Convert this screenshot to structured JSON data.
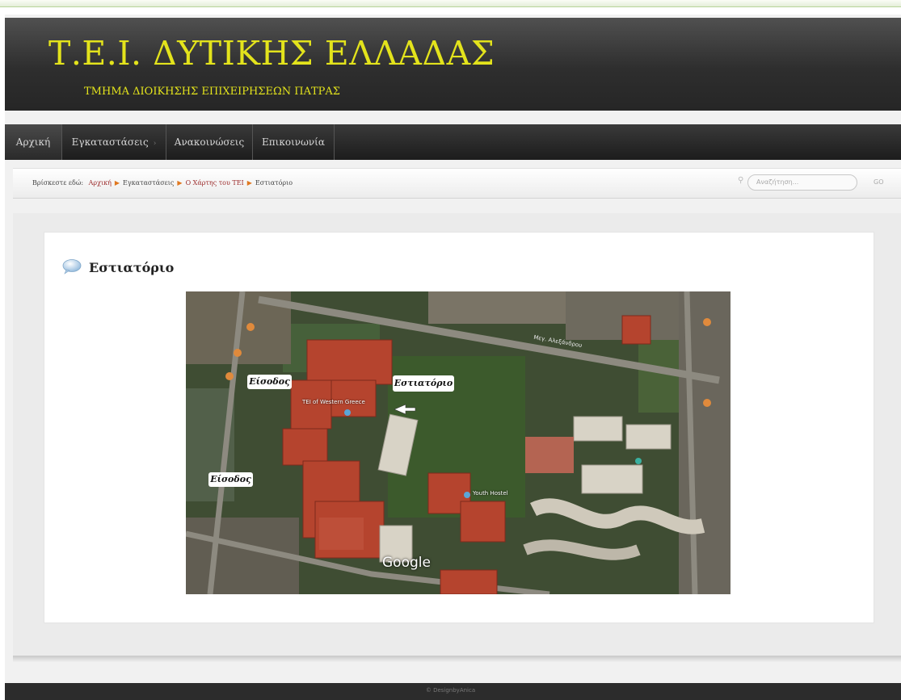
{
  "header": {
    "title": "Τ.Ε.Ι. ΔΥΤΙΚΗΣ ΕΛΛΑΔΑΣ",
    "subtitle": "ΤΜΗΜΑ ΔΙΟΙΚΗΣΗΣ ΕΠΙΧΕΙΡΗΣΕΩΝ ΠΑΤΡΑΣ",
    "title_color": "#e3e31c"
  },
  "nav": {
    "items": [
      {
        "label": "Αρχική"
      },
      {
        "label": "Εγκαταστάσεις",
        "has_dropdown": true
      },
      {
        "label": "Ανακοινώσεις"
      },
      {
        "label": "Επικοινωνία"
      }
    ]
  },
  "breadcrumb": {
    "prefix": "Βρίσκεστε εδώ:",
    "items": [
      "Αρχική",
      "Εγκαταστάσεις",
      "Ο Χάρτης του ΤΕΙ",
      "Εστιατόριο"
    ]
  },
  "search": {
    "placeholder": "Αναζήτηση...",
    "go_label": "GO"
  },
  "article": {
    "title": "Εστιατόριο"
  },
  "map": {
    "callout_restaurant": "Εστιατόριο",
    "callout_entrance_1": "Είσοδος",
    "callout_entrance_2": "Είσοδος",
    "place_tei": "TEI of Western Greece",
    "place_hostel": "Youth Hostel",
    "street_top": "Μεγ. Αλεξάνδρου",
    "logo": "Google"
  },
  "footer": {
    "text": "© DesignbyAnica"
  },
  "colors": {
    "accent_link": "#9b2a2a",
    "breadcrumb_separator": "#e07820",
    "roof_red": "#b5442e"
  }
}
